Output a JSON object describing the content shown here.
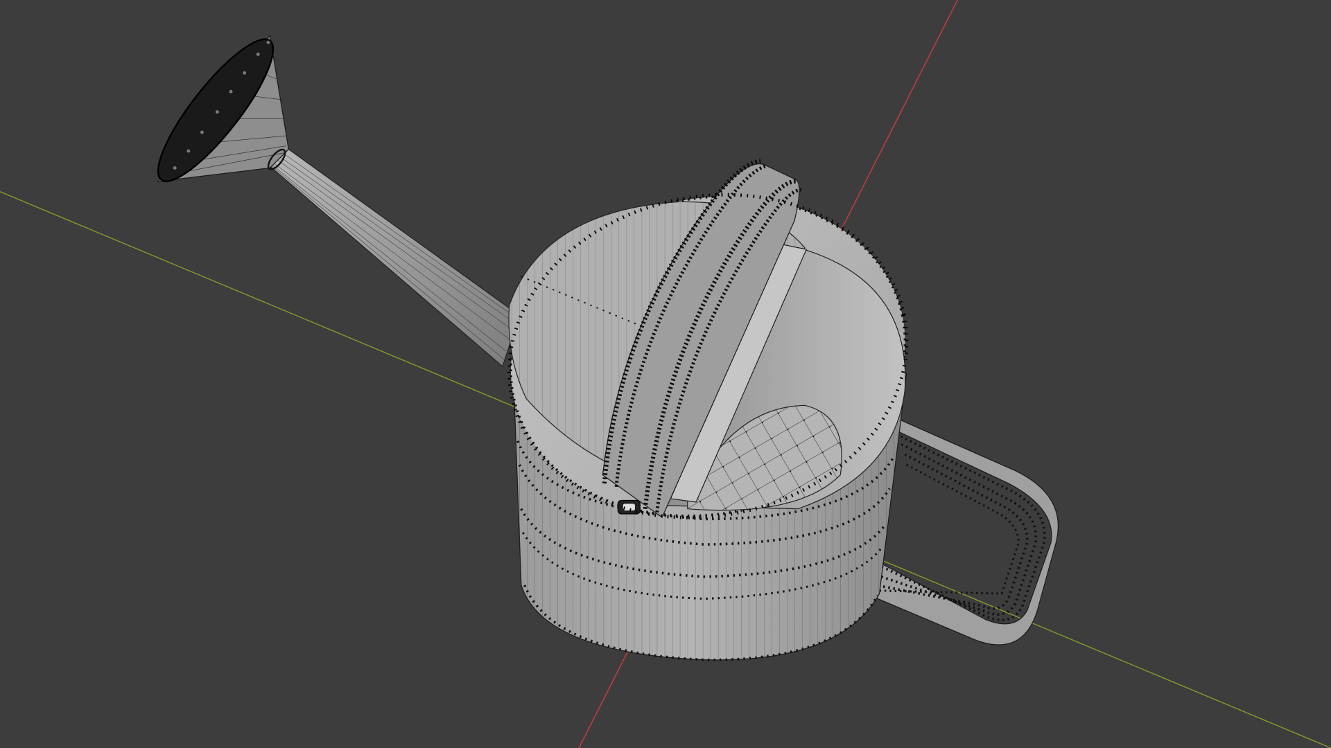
{
  "viewport": {
    "mode": "edit-mode-wireframe",
    "object": "watering-can",
    "background_color": "#3d3d3d"
  },
  "axes": {
    "x_axis_color": "#c83c3c",
    "y_axis_color": "#7f9a2b"
  },
  "mesh": {
    "face_color": "#a8a8a8",
    "face_shadow_color": "#7a7a7a",
    "edge_color": "#1a1a1a",
    "vertex_color": "#050505"
  }
}
